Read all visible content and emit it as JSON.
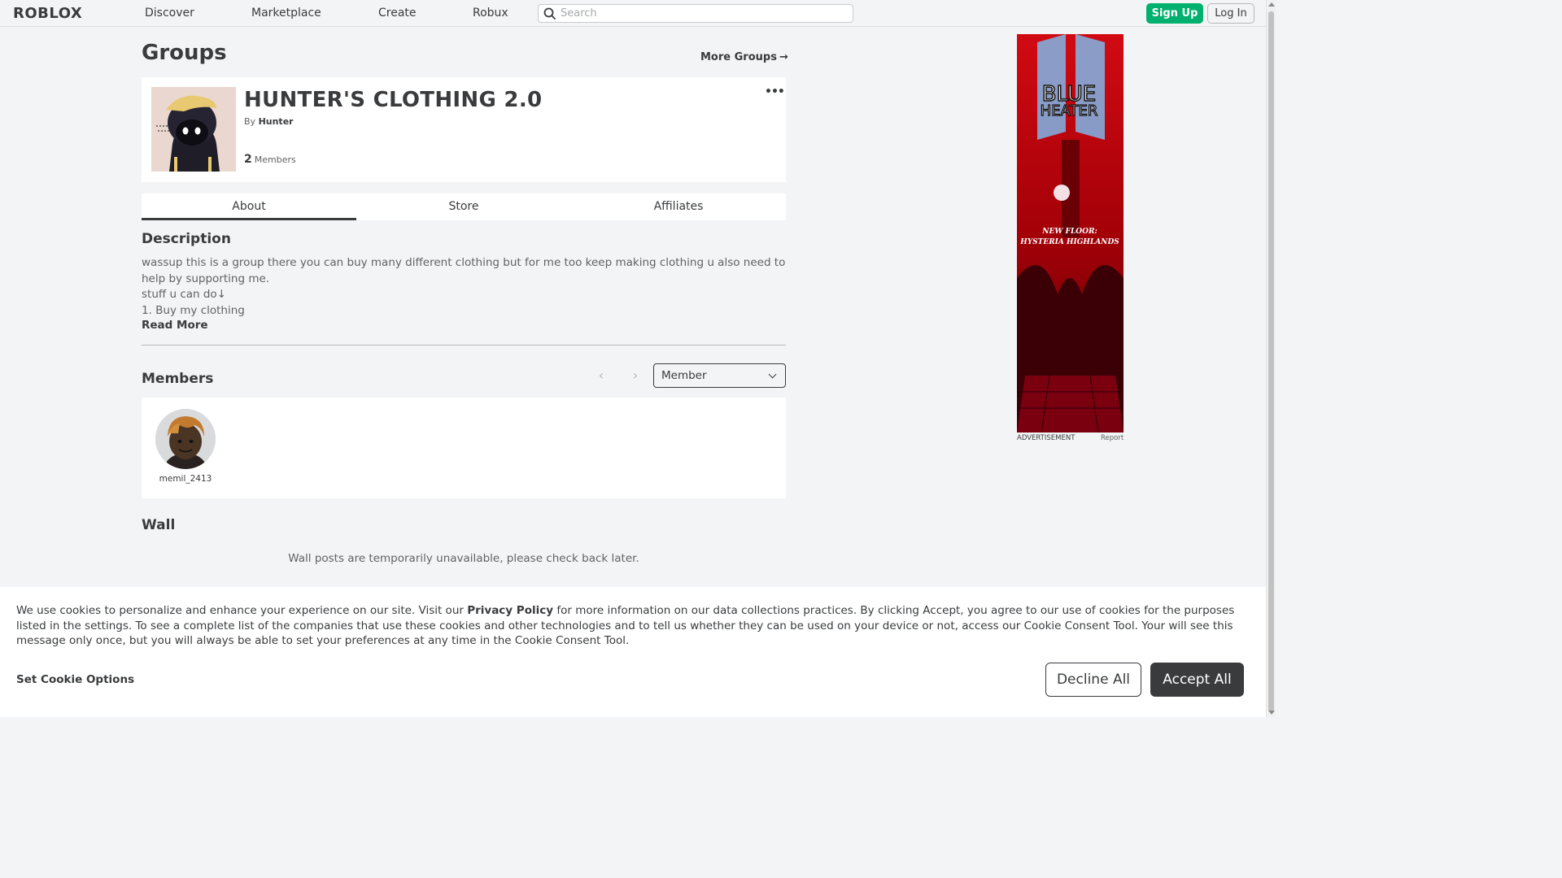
{
  "header": {
    "logo": "ROBLOX",
    "nav": [
      "Discover",
      "Marketplace",
      "Create",
      "Robux"
    ],
    "search_placeholder": "Search",
    "signup_label": "Sign Up",
    "login_label": "Log In"
  },
  "page": {
    "title": "Groups",
    "more_groups_label": "More Groups",
    "more_groups_arrow": "→"
  },
  "group": {
    "name": "HUNTER'S CLOTHING 2.0",
    "by_prefix": "By",
    "owner": "Hunter",
    "member_count": "2",
    "members_label": "Members",
    "more_menu": "•••"
  },
  "tabs": [
    "About",
    "Store",
    "Affiliates"
  ],
  "active_tab": "About",
  "description": {
    "title": "Description",
    "lines": [
      "wassup this is a group there you can buy many different clothing but for me too keep making clothing u also need to help by supporting me.",
      "stuff u can do↓",
      "1. Buy my clothing"
    ],
    "read_more": "Read More"
  },
  "members": {
    "title": "Members",
    "prev": "‹",
    "next": "›",
    "role_selected": "Member",
    "list": [
      {
        "name": "memil_2413"
      }
    ]
  },
  "wall": {
    "title": "Wall",
    "message": "Wall posts are temporarily unavailable, please check back later."
  },
  "ad": {
    "headline_line1": "BLUE",
    "headline_line2": "HEATER",
    "subline1": "NEW FLOOR:",
    "subline2": "HYSTERIA HIGHLANDS",
    "label": "ADVERTISEMENT",
    "report": "Report"
  },
  "cookie": {
    "text_before": "We use cookies to personalize and enhance your experience on our site. Visit our ",
    "privacy_link": "Privacy Policy",
    "text_after": " for more information on our data collections practices. By clicking Accept, you agree to our use of cookies for the purposes listed in the settings. To see a complete list of the companies that use these cookies and other technologies and to tell us whether they can be used on your device or not, access our Cookie Consent Tool. Your will see this message only once, but you will always be able to set your preferences at any time in the Cookie Consent Tool.",
    "options_label": "Set Cookie Options",
    "decline_label": "Decline All",
    "accept_label": "Accept All"
  },
  "colors": {
    "accent_green": "#00b06f",
    "text_dark": "#393b3d",
    "bg": "#f2f4f5",
    "ad_red": "#b00007"
  }
}
